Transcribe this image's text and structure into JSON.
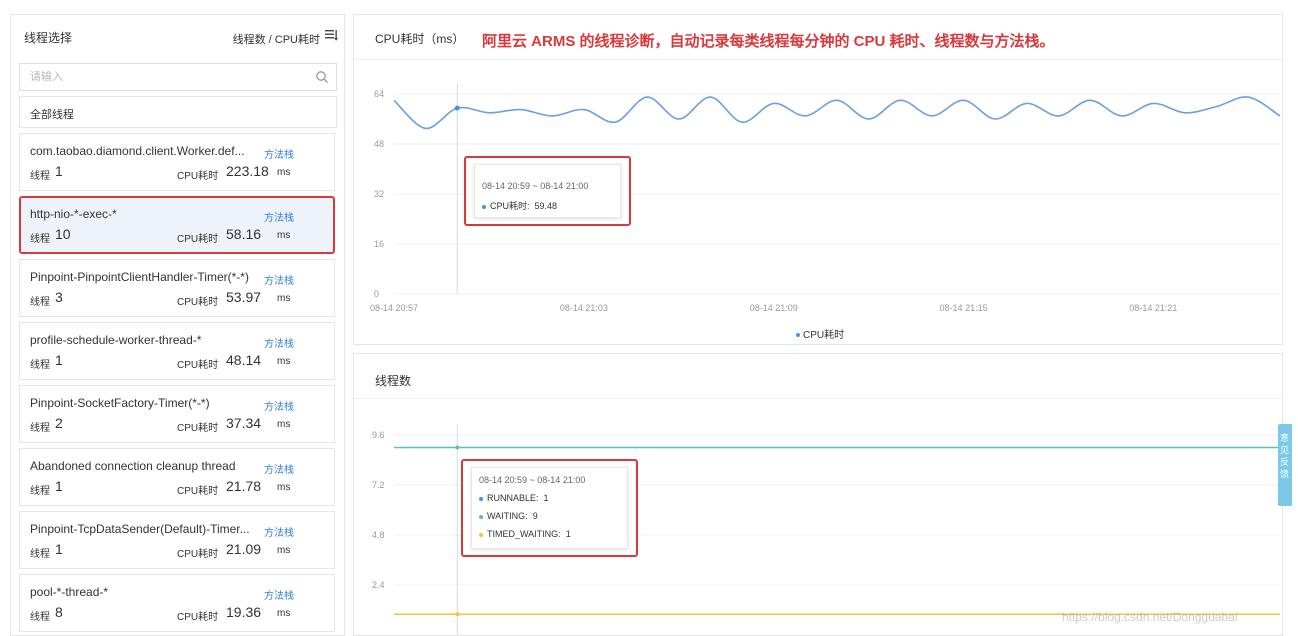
{
  "left": {
    "title": "线程选择",
    "sort_label": "线程数 / CPU耗时",
    "search_placeholder": "请输入",
    "all_threads": "全部线程",
    "method_link": "方法栈",
    "count_label": "线程",
    "cpu_label": "CPU耗时",
    "cpu_unit": "ms",
    "threads": [
      {
        "name": "com.taobao.diamond.client.Worker.def...",
        "count": "1",
        "cpu": "223.18"
      },
      {
        "name": "http-nio-*-exec-*",
        "count": "10",
        "cpu": "58.16"
      },
      {
        "name": "Pinpoint-PinpointClientHandler-Timer(*-*)",
        "count": "3",
        "cpu": "53.97"
      },
      {
        "name": "profile-schedule-worker-thread-*",
        "count": "1",
        "cpu": "48.14"
      },
      {
        "name": "Pinpoint-SocketFactory-Timer(*-*)",
        "count": "2",
        "cpu": "37.34"
      },
      {
        "name": "Abandoned connection cleanup thread",
        "count": "1",
        "cpu": "21.78"
      },
      {
        "name": "Pinpoint-TcpDataSender(Default)-Timer...",
        "count": "1",
        "cpu": "21.09"
      },
      {
        "name": "pool-*-thread-*",
        "count": "8",
        "cpu": "19.36"
      }
    ],
    "selected_index": 1
  },
  "cpu_panel": {
    "title": "CPU耗时（ms）",
    "annotation": "阿里云 ARMS 的线程诊断，自动记录每类线程每分钟的 CPU 耗时、线程数与方法栈。",
    "legend": "CPU耗时",
    "tooltip": {
      "time": "08-14 20:59 ~ 08-14 21:00",
      "label": "CPU耗时",
      "value": "59.48"
    }
  },
  "thread_panel": {
    "title": "线程数",
    "tooltip": {
      "time": "08-14 20:59 ~ 08-14 21:00",
      "rows": [
        {
          "label": "RUNNABLE",
          "value": "1",
          "color": "#4a90e2"
        },
        {
          "label": "WAITING",
          "value": "9",
          "color": "#5cc0b5"
        },
        {
          "label": "TIMED_WAITING",
          "value": "1",
          "color": "#f5c243"
        }
      ]
    }
  },
  "side_tab": "意见反馈",
  "watermark": "https://blog.csdn.net/Dongguabai",
  "colors": {
    "cpu_line": "#6a9fe0",
    "waiting": "#5cc0b5",
    "runnable": "#4a90e2",
    "timed_waiting": "#f5c243",
    "highlight": "#d9393c"
  },
  "chart_data": [
    {
      "type": "line",
      "title": "CPU耗时（ms）",
      "x": [
        "08-14 20:57",
        "08-14 20:58",
        "08-14 20:59",
        "08-14 21:00",
        "08-14 21:01",
        "08-14 21:02",
        "08-14 21:03",
        "08-14 21:04",
        "08-14 21:05",
        "08-14 21:06",
        "08-14 21:07",
        "08-14 21:08",
        "08-14 21:09",
        "08-14 21:10",
        "08-14 21:11",
        "08-14 21:12",
        "08-14 21:13",
        "08-14 21:14",
        "08-14 21:15",
        "08-14 21:16",
        "08-14 21:17",
        "08-14 21:18",
        "08-14 21:19",
        "08-14 21:20",
        "08-14 21:21",
        "08-14 21:22",
        "08-14 21:23",
        "08-14 21:24",
        "08-14 21:25"
      ],
      "x_ticks": [
        "08-14 20:57",
        "08-14 21:03",
        "08-14 21:09",
        "08-14 21:15",
        "08-14 21:21"
      ],
      "series": [
        {
          "name": "CPU耗时",
          "values": [
            62,
            53,
            59.48,
            58,
            59,
            57,
            59,
            55,
            63,
            56,
            63,
            55,
            61,
            57,
            62,
            56,
            62,
            57,
            62,
            56,
            61,
            57,
            62,
            57,
            61,
            58,
            60,
            63,
            57
          ]
        }
      ],
      "y_ticks": [
        "0",
        "16",
        "32",
        "48",
        "64"
      ],
      "ylim": [
        0,
        64
      ],
      "legend": "bottom-center",
      "grid": true
    },
    {
      "type": "line",
      "title": "线程数",
      "y_ticks": [
        "2.4",
        "4.8",
        "7.2",
        "9.6"
      ],
      "ylim": [
        0,
        9.6
      ],
      "series": [
        {
          "name": "WAITING",
          "values": [
            9,
            9,
            9,
            9,
            9,
            9,
            9,
            9,
            9,
            9,
            9,
            9,
            9,
            9,
            9,
            9,
            9,
            9,
            9,
            9,
            9,
            9,
            9,
            9,
            9,
            9,
            9,
            9,
            9
          ]
        },
        {
          "name": "RUNNABLE",
          "values": [
            1,
            1,
            1,
            1,
            1,
            1,
            1,
            1,
            1,
            1,
            1,
            1,
            1,
            1,
            1,
            1,
            1,
            1,
            1,
            1,
            1,
            1,
            1,
            1,
            1,
            1,
            1,
            1,
            1
          ]
        },
        {
          "name": "TIMED_WAITING",
          "values": [
            1,
            1,
            1,
            1,
            1,
            1,
            1,
            1,
            1,
            1,
            1,
            1,
            1,
            1,
            1,
            1,
            1,
            1,
            1,
            1,
            1,
            1,
            1,
            1,
            1,
            1,
            1,
            1,
            1
          ]
        }
      ],
      "grid": true
    }
  ]
}
